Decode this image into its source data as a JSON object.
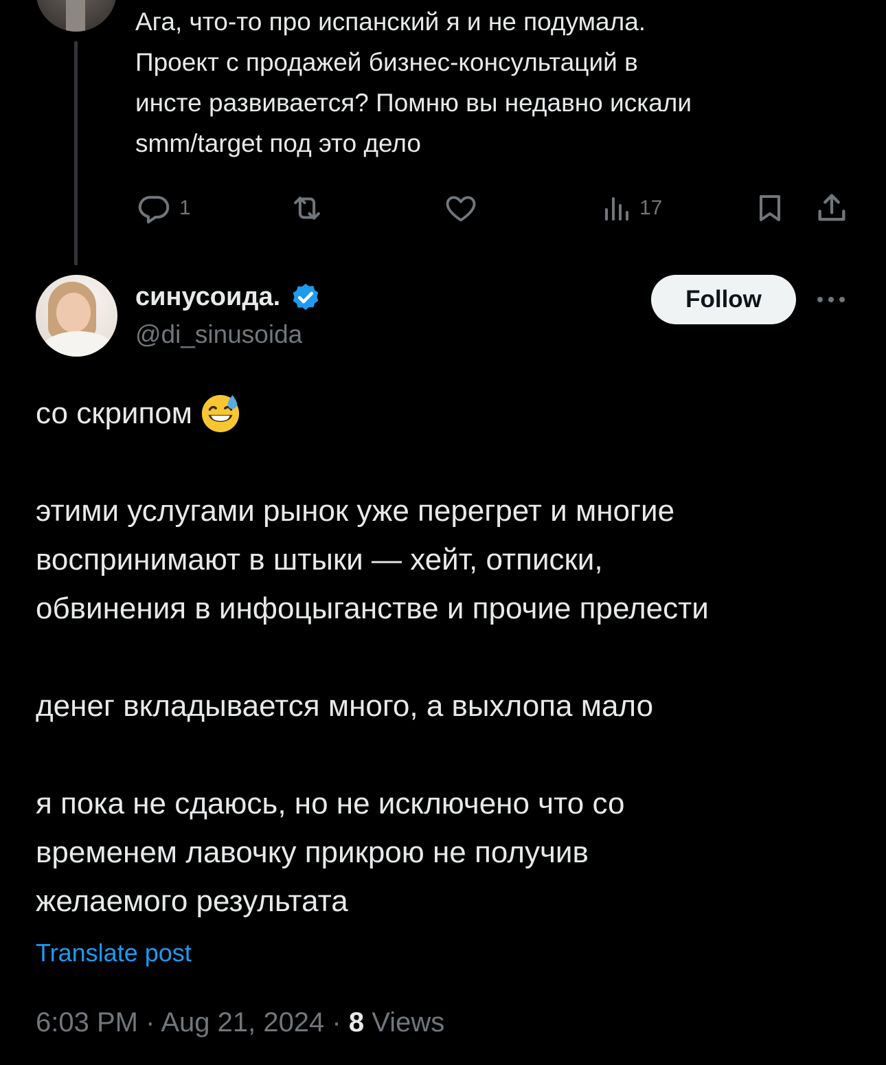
{
  "parent_tweet": {
    "text_lines": [
      "Ага, что-то про испанский я и не подумала.",
      "Проект с продажей бизнес-консультаций в",
      "инсте развивается? Помню вы недавно искали",
      "smm/target под это дело"
    ],
    "actions": {
      "reply_icon": "reply-icon",
      "reply_count": "1",
      "retweet_icon": "retweet-icon",
      "like_icon": "heart-icon",
      "views_icon": "views-bar-icon",
      "views_count": "17",
      "bookmark_icon": "bookmark-icon",
      "share_icon": "share-icon"
    }
  },
  "tweet": {
    "display_name": "синусоида.",
    "verified_icon": "verified-badge-icon",
    "handle": "@di_sinusoida",
    "follow_label": "Follow",
    "more_icon": "more-dots-icon",
    "body": {
      "para1": "со скрипом",
      "para1_emoji": "grinning-face-with-sweat-emoji",
      "para2_lines": [
        "этими услугами рынок уже перегрет и многие",
        "воспринимают в штыки — хейт, отписки,",
        "обвинения в инфоцыганстве и прочие прелести"
      ],
      "para3": "денег вкладывается много, а выхлопа мало",
      "para4_lines": [
        "я пока не сдаюсь, но не исключено что со",
        "временем лавочку прикрою не получив",
        "желаемого результата"
      ]
    },
    "translate_label": "Translate post",
    "time": "6:03 PM",
    "separator": " · ",
    "date": "Aug 21, 2024",
    "views_count": "8",
    "views_label": "Views"
  },
  "colors": {
    "background": "#000000",
    "text_primary": "#e7e9ea",
    "text_secondary": "#71767b",
    "accent_blue": "#1d9bf0",
    "follow_bg": "#eff3f4"
  }
}
